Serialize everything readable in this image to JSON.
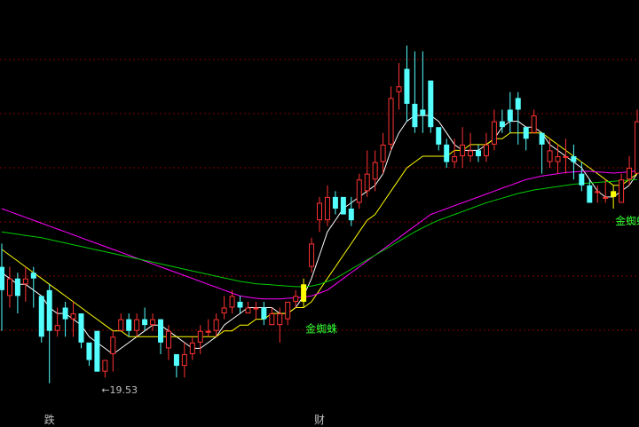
{
  "chart_data": {
    "type": "candlestick",
    "title": "",
    "xlabel": "",
    "ylabel": "",
    "grid": true,
    "colors": {
      "background": "#000000",
      "up": "#ff3232",
      "down": "#54ffff",
      "signal": "#ffff00",
      "ma_white": "#ffffff",
      "ma_yellow": "#ffff00",
      "ma_magenta": "#ff00ff",
      "ma_green": "#00cc00",
      "grid": "#800000",
      "label_green": "#33ff33"
    },
    "candles": [
      {
        "o": 20.5,
        "c": 20.1,
        "h": 20.9,
        "l": 19.4
      },
      {
        "o": 20.0,
        "c": 20.3,
        "h": 20.5,
        "l": 19.8
      },
      {
        "o": 20.3,
        "c": 20.0,
        "h": 20.4,
        "l": 19.7
      },
      {
        "o": 20.2,
        "c": 20.3,
        "h": 20.5,
        "l": 19.9
      },
      {
        "o": 20.4,
        "c": 20.3,
        "h": 20.5,
        "l": 19.8
      },
      {
        "o": 20.0,
        "c": 19.3,
        "h": 20.0,
        "l": 19.2
      },
      {
        "o": 20.1,
        "c": 19.4,
        "h": 20.2,
        "l": 18.5
      },
      {
        "o": 19.4,
        "c": 19.5,
        "h": 19.8,
        "l": 19.3
      },
      {
        "o": 19.8,
        "c": 19.6,
        "h": 19.9,
        "l": 19.3
      },
      {
        "o": 19.6,
        "c": 19.7,
        "h": 19.9,
        "l": 19.3
      },
      {
        "o": 19.7,
        "c": 19.2,
        "h": 19.7,
        "l": 19.1
      },
      {
        "o": 19.2,
        "c": 18.9,
        "h": 19.2,
        "l": 18.8
      },
      {
        "o": 19.4,
        "c": 18.7,
        "h": 19.4,
        "l": 18.7
      },
      {
        "o": 18.7,
        "c": 18.9,
        "h": 18.9,
        "l": 18.6
      },
      {
        "o": 19.0,
        "c": 19.3,
        "h": 19.4,
        "l": 18.7
      },
      {
        "o": 19.4,
        "c": 19.6,
        "h": 19.7,
        "l": 19.4
      },
      {
        "o": 19.6,
        "c": 19.4,
        "h": 19.7,
        "l": 19.3
      },
      {
        "o": 19.4,
        "c": 19.6,
        "h": 19.7,
        "l": 19.3
      },
      {
        "o": 19.6,
        "c": 19.5,
        "h": 19.8,
        "l": 19.4
      },
      {
        "o": 19.5,
        "c": 19.6,
        "h": 19.7,
        "l": 19.4
      },
      {
        "o": 19.6,
        "c": 19.2,
        "h": 19.6,
        "l": 19.0
      },
      {
        "o": 19.1,
        "c": 19.4,
        "h": 19.5,
        "l": 18.9
      },
      {
        "o": 19.0,
        "c": 18.8,
        "h": 19.0,
        "l": 18.6
      },
      {
        "o": 18.8,
        "c": 19.0,
        "h": 19.2,
        "l": 18.6
      },
      {
        "o": 19.0,
        "c": 19.2,
        "h": 19.3,
        "l": 18.9
      },
      {
        "o": 19.2,
        "c": 19.4,
        "h": 19.5,
        "l": 19.0
      },
      {
        "o": 19.4,
        "c": 19.4,
        "h": 19.6,
        "l": 19.3
      },
      {
        "o": 19.4,
        "c": 19.6,
        "h": 19.7,
        "l": 19.3
      },
      {
        "o": 19.7,
        "c": 19.8,
        "h": 20.0,
        "l": 19.6
      },
      {
        "o": 19.8,
        "c": 20.0,
        "h": 20.1,
        "l": 19.7
      },
      {
        "o": 19.9,
        "c": 19.8,
        "h": 20.0,
        "l": 19.7
      },
      {
        "o": 19.7,
        "c": 19.8,
        "h": 19.9,
        "l": 19.7
      },
      {
        "o": 19.8,
        "c": 19.8,
        "h": 19.9,
        "l": 19.6
      },
      {
        "o": 19.8,
        "c": 19.6,
        "h": 19.9,
        "l": 19.5
      },
      {
        "o": 19.5,
        "c": 19.7,
        "h": 19.8,
        "l": 19.5
      },
      {
        "o": 19.5,
        "c": 19.7,
        "h": 19.8,
        "l": 19.2
      },
      {
        "o": 19.6,
        "c": 19.9,
        "h": 19.9,
        "l": 19.5
      },
      {
        "o": 19.9,
        "c": 20.0,
        "h": 20.1,
        "l": 19.8
      },
      {
        "o": 19.9,
        "c": 20.2,
        "h": 20.3,
        "l": 19.8
      },
      {
        "o": 20.5,
        "c": 20.9,
        "h": 21.0,
        "l": 20.4
      },
      {
        "o": 21.3,
        "c": 21.6,
        "h": 21.7,
        "l": 21.1
      },
      {
        "o": 21.3,
        "c": 21.7,
        "h": 21.9,
        "l": 21.2
      },
      {
        "o": 21.7,
        "c": 21.5,
        "h": 21.8,
        "l": 21.4
      },
      {
        "o": 21.7,
        "c": 21.4,
        "h": 21.7,
        "l": 21.4
      },
      {
        "o": 21.5,
        "c": 21.3,
        "h": 21.7,
        "l": 21.2
      },
      {
        "o": 21.6,
        "c": 22.0,
        "h": 22.1,
        "l": 21.5
      },
      {
        "o": 21.8,
        "c": 22.1,
        "h": 22.5,
        "l": 21.7
      },
      {
        "o": 22.0,
        "c": 22.3,
        "h": 22.5,
        "l": 21.8
      },
      {
        "o": 22.3,
        "c": 22.6,
        "h": 22.8,
        "l": 22.1
      },
      {
        "o": 22.6,
        "c": 23.4,
        "h": 23.6,
        "l": 22.5
      },
      {
        "o": 23.5,
        "c": 23.6,
        "h": 24.0,
        "l": 23.2
      },
      {
        "o": 23.9,
        "c": 23.3,
        "h": 24.3,
        "l": 23.0
      },
      {
        "o": 23.3,
        "c": 22.9,
        "h": 24.2,
        "l": 22.8
      },
      {
        "o": 23.2,
        "c": 23.1,
        "h": 24.2,
        "l": 22.8
      },
      {
        "o": 23.7,
        "c": 22.9,
        "h": 23.7,
        "l": 22.8
      },
      {
        "o": 22.9,
        "c": 22.6,
        "h": 22.8,
        "l": 22.5
      },
      {
        "o": 22.6,
        "c": 22.3,
        "h": 22.7,
        "l": 22.2
      },
      {
        "o": 22.3,
        "c": 22.4,
        "h": 22.7,
        "l": 22.2
      },
      {
        "o": 22.4,
        "c": 22.6,
        "h": 22.9,
        "l": 22.2
      },
      {
        "o": 22.4,
        "c": 22.5,
        "h": 22.8,
        "l": 22.3
      },
      {
        "o": 22.5,
        "c": 22.4,
        "h": 22.6,
        "l": 22.3
      },
      {
        "o": 22.4,
        "c": 22.6,
        "h": 22.8,
        "l": 22.3
      },
      {
        "o": 22.6,
        "c": 23.0,
        "h": 23.2,
        "l": 22.5
      },
      {
        "o": 23.0,
        "c": 22.9,
        "h": 23.2,
        "l": 22.8
      },
      {
        "o": 23.2,
        "c": 23.0,
        "h": 23.5,
        "l": 22.8
      },
      {
        "o": 23.4,
        "c": 23.2,
        "h": 23.5,
        "l": 22.6
      },
      {
        "o": 22.9,
        "c": 22.7,
        "h": 22.9,
        "l": 22.5
      },
      {
        "o": 22.8,
        "c": 23.1,
        "h": 23.2,
        "l": 22.8
      },
      {
        "o": 22.8,
        "c": 22.6,
        "h": 22.8,
        "l": 22.1
      },
      {
        "o": 22.3,
        "c": 22.5,
        "h": 22.7,
        "l": 22.2
      },
      {
        "o": 22.3,
        "c": 22.4,
        "h": 22.6,
        "l": 22.1
      },
      {
        "o": 22.4,
        "c": 22.4,
        "h": 22.7,
        "l": 22.1
      },
      {
        "o": 22.4,
        "c": 22.3,
        "h": 22.6,
        "l": 22.0
      },
      {
        "o": 22.1,
        "c": 21.9,
        "h": 22.3,
        "l": 21.8
      },
      {
        "o": 21.9,
        "c": 21.6,
        "h": 22.0,
        "l": 21.6
      },
      {
        "o": 21.8,
        "c": 21.8,
        "h": 21.9,
        "l": 21.6
      },
      {
        "o": 21.7,
        "c": 21.7,
        "h": 22.0,
        "l": 21.6
      },
      {
        "o": 21.8,
        "c": 21.7,
        "h": 21.9,
        "l": 21.5
      },
      {
        "o": 21.6,
        "c": 22.0,
        "h": 22.1,
        "l": 21.6
      },
      {
        "o": 22.0,
        "c": 22.2,
        "h": 22.4,
        "l": 21.9
      },
      {
        "o": 22.1,
        "c": 23.0,
        "h": 23.2,
        "l": 22.1
      }
    ],
    "signals": [
      {
        "index": 38,
        "label": "金蜘蛛",
        "label_pos": "below"
      },
      {
        "index": 77,
        "label": "金蜘蛛",
        "label_pos": "right"
      }
    ],
    "ma": [
      {
        "color": "#ffffff",
        "values": [
          20.4,
          20.3,
          20.2,
          20.2,
          20.1,
          20.0,
          19.8,
          19.7,
          19.7,
          19.6,
          19.5,
          19.3,
          19.2,
          19.1,
          19.0,
          19.1,
          19.2,
          19.3,
          19.4,
          19.5,
          19.5,
          19.4,
          19.3,
          19.2,
          19.1,
          19.1,
          19.2,
          19.3,
          19.5,
          19.6,
          19.7,
          19.8,
          19.8,
          19.8,
          19.8,
          19.7,
          19.7,
          19.8,
          20.0,
          20.3,
          20.7,
          21.1,
          21.3,
          21.5,
          21.6,
          21.7,
          21.8,
          21.9,
          22.1,
          22.5,
          22.8,
          23.0,
          23.1,
          23.1,
          23.1,
          23.0,
          22.8,
          22.6,
          22.5,
          22.5,
          22.5,
          22.6,
          22.7,
          22.9,
          23.0,
          23.0,
          22.9,
          22.9,
          22.8,
          22.6,
          22.5,
          22.4,
          22.3,
          22.2,
          22.0,
          21.8,
          21.7,
          21.7,
          21.8,
          21.9,
          22.1
        ]
      },
      {
        "color": "#ffff00",
        "values": [
          20.8,
          20.7,
          20.6,
          20.5,
          20.4,
          20.3,
          20.2,
          20.1,
          20.0,
          19.9,
          19.8,
          19.7,
          19.6,
          19.5,
          19.4,
          19.4,
          19.3,
          19.3,
          19.3,
          19.3,
          19.3,
          19.3,
          19.3,
          19.3,
          19.3,
          19.3,
          19.3,
          19.3,
          19.4,
          19.4,
          19.5,
          19.5,
          19.6,
          19.6,
          19.7,
          19.7,
          19.7,
          19.8,
          19.8,
          19.9,
          20.1,
          20.3,
          20.5,
          20.7,
          20.9,
          21.1,
          21.3,
          21.4,
          21.6,
          21.8,
          22.0,
          22.2,
          22.3,
          22.4,
          22.4,
          22.4,
          22.4,
          22.5,
          22.5,
          22.6,
          22.6,
          22.6,
          22.7,
          22.7,
          22.8,
          22.8,
          22.8,
          22.8,
          22.8,
          22.7,
          22.6,
          22.5,
          22.4,
          22.3,
          22.2,
          22.1,
          22.0,
          21.9,
          21.9,
          22.0,
          22.1
        ]
      },
      {
        "color": "#ff00ff",
        "values": [
          21.5,
          21.45,
          21.4,
          21.35,
          21.3,
          21.25,
          21.2,
          21.15,
          21.1,
          21.05,
          21.0,
          20.95,
          20.9,
          20.85,
          20.8,
          20.75,
          20.7,
          20.65,
          20.6,
          20.55,
          20.5,
          20.45,
          20.4,
          20.35,
          20.3,
          20.25,
          20.2,
          20.15,
          20.1,
          20.05,
          20.0,
          19.98,
          19.96,
          19.95,
          19.95,
          19.95,
          19.96,
          19.97,
          19.98,
          20.0,
          20.05,
          20.1,
          20.2,
          20.3,
          20.4,
          20.5,
          20.6,
          20.7,
          20.8,
          20.9,
          21.0,
          21.1,
          21.2,
          21.3,
          21.4,
          21.45,
          21.5,
          21.55,
          21.6,
          21.65,
          21.7,
          21.75,
          21.8,
          21.85,
          21.9,
          21.95,
          22.0,
          22.03,
          22.06,
          22.08,
          22.1,
          22.12,
          22.13,
          22.14,
          22.14,
          22.13,
          22.12,
          22.11,
          22.12,
          22.13,
          22.15
        ]
      },
      {
        "color": "#00cc00",
        "values": [
          21.1,
          21.08,
          21.06,
          21.04,
          21.02,
          21.0,
          20.97,
          20.94,
          20.91,
          20.88,
          20.85,
          20.82,
          20.79,
          20.76,
          20.73,
          20.7,
          20.67,
          20.64,
          20.61,
          20.58,
          20.55,
          20.52,
          20.49,
          20.46,
          20.43,
          20.4,
          20.37,
          20.34,
          20.31,
          20.28,
          20.25,
          20.23,
          20.21,
          20.2,
          20.19,
          20.18,
          20.17,
          20.16,
          20.16,
          20.17,
          20.2,
          20.25,
          20.3,
          20.38,
          20.46,
          20.54,
          20.62,
          20.7,
          20.78,
          20.86,
          20.94,
          21.02,
          21.1,
          21.17,
          21.24,
          21.3,
          21.35,
          21.4,
          21.45,
          21.5,
          21.55,
          21.6,
          21.64,
          21.68,
          21.72,
          21.76,
          21.79,
          21.82,
          21.84,
          21.86,
          21.88,
          21.9,
          21.92,
          21.93,
          21.94,
          21.95,
          21.96,
          21.97,
          21.98,
          21.99,
          22.0
        ]
      }
    ],
    "ylim": [
      18.1,
      24.9
    ],
    "annotations": {
      "low_label": "←19.53",
      "low_index": 13,
      "bottom_labels": [
        {
          "text": "跌",
          "index": 6
        },
        {
          "text": "财",
          "index": 40
        }
      ]
    }
  }
}
